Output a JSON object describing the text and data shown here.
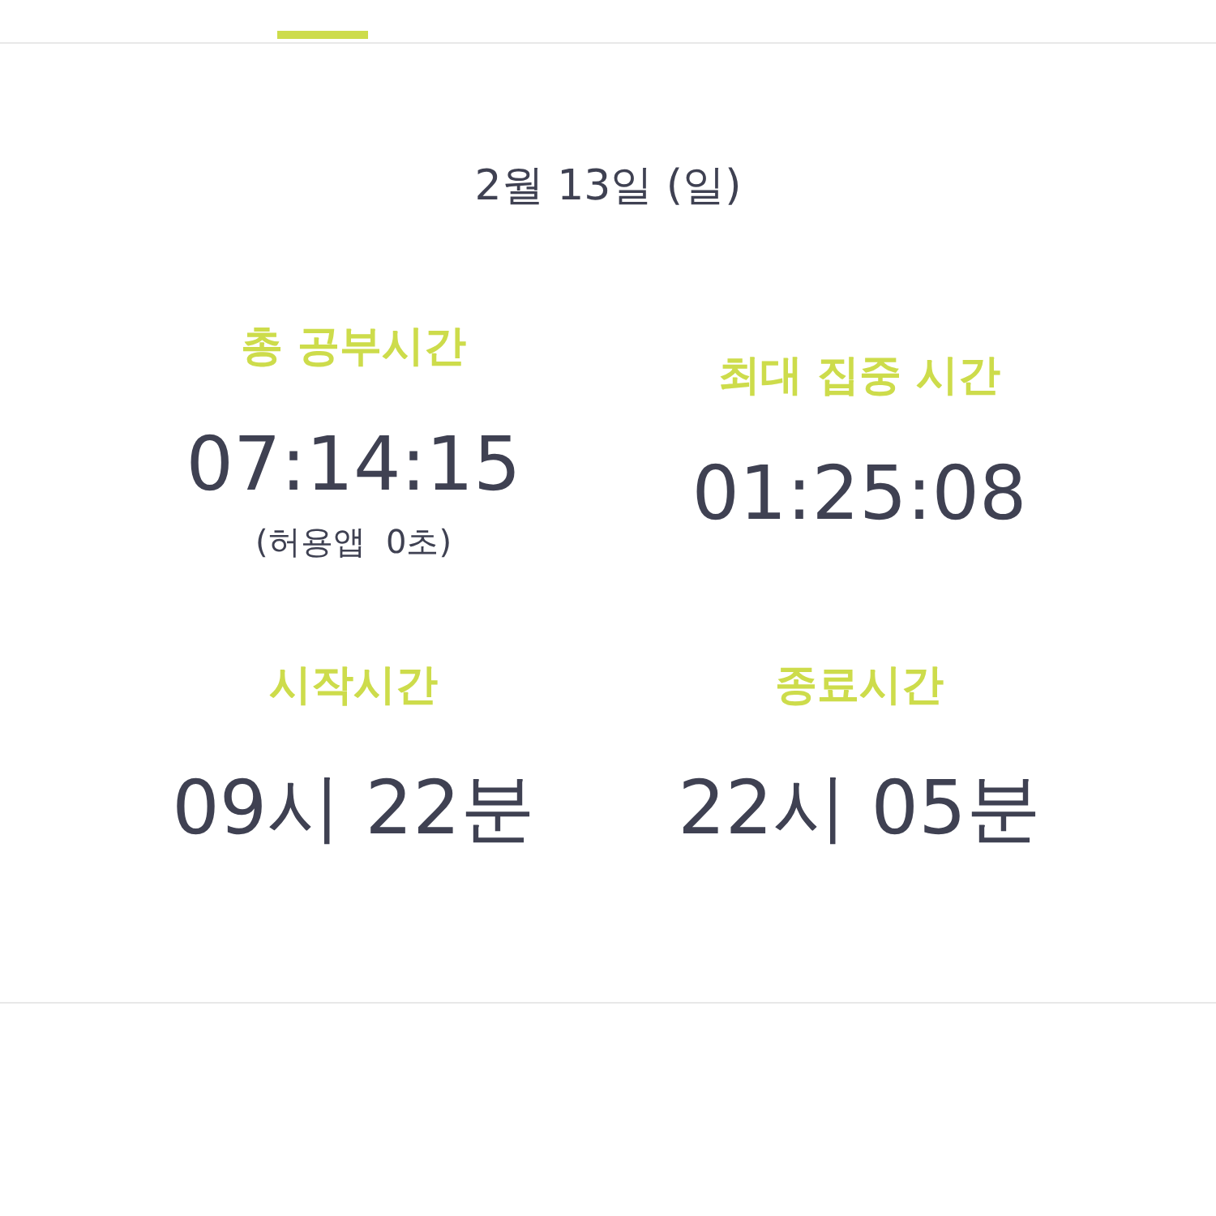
{
  "date": "2월 13일 (일)",
  "stats": [
    {
      "label": "총 공부시간",
      "value": "07:14:15",
      "note": "(허용앱  0초)"
    },
    {
      "label": "최대 집중 시간",
      "value": "01:25:08"
    },
    {
      "label": "시작시간",
      "value": "09시 22분"
    },
    {
      "label": "종료시간",
      "value": "22시 05분"
    }
  ]
}
